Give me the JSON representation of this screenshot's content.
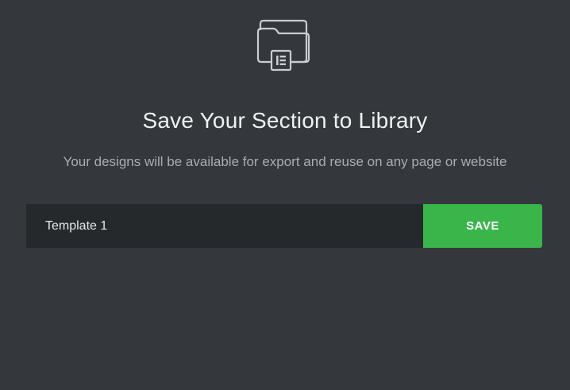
{
  "dialog": {
    "icon": "folder-with-elementor-icon",
    "title": "Save Your Section to Library",
    "subtitle": "Your designs will be available for export and reuse on any page or website",
    "name_input": {
      "value": "Template 1",
      "placeholder": ""
    },
    "save_label": "SAVE"
  },
  "colors": {
    "background": "#34383c",
    "input_background": "#26292c",
    "accent": "#39b54a",
    "title_text": "#eef0f2",
    "subtitle_text": "#a9adb2"
  }
}
